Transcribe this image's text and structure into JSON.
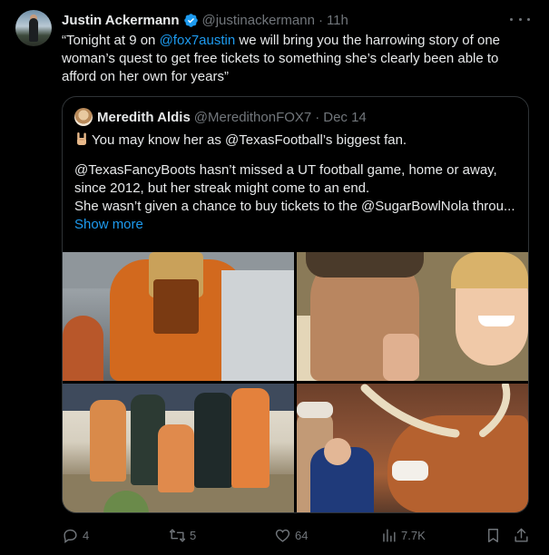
{
  "author": {
    "name": "Justin Ackermann",
    "handle": "@justinackermann",
    "separator": "·",
    "time": "11h"
  },
  "tweet": {
    "text_before": "“Tonight at 9 on ",
    "mention": "@fox7austin",
    "text_after": " we will bring you the harrowing story of one woman’s quest to get free tickets to something she’s clearly been able to afford on her own for years”"
  },
  "quote": {
    "name": "Meredith Aldis",
    "handle": "@MeredithonFOX7",
    "separator": "·",
    "date": "Dec 14",
    "lines": [
      "You may know her as @TexasFootball’s biggest fan.",
      "@TexasFancyBoots hasn’t missed a UT football game, home or away,",
      "since 2012, but her streak might come to an end.",
      "She wasn’t given a chance to buy tickets to the @SugarBowlNola throu..."
    ],
    "show_more": "Show more"
  },
  "media": [
    {
      "label": "Fan in orange fringe outfit at stadium",
      "icon": "photo"
    },
    {
      "label": "Selfie with celebrity in car",
      "icon": "photo"
    },
    {
      "label": "Group photo with Texas players",
      "icon": "photo"
    },
    {
      "label": "Fan with longhorn mascot",
      "icon": "photo"
    }
  ],
  "actions": {
    "replies": "4",
    "reposts": "5",
    "likes": "64",
    "views": "7.7K"
  },
  "colors": {
    "background": "#000000",
    "text": "#e7e9ea",
    "muted": "#71767b",
    "link": "#1d9bf0",
    "border": "#2f3336",
    "verified": "#1d9bf0"
  }
}
